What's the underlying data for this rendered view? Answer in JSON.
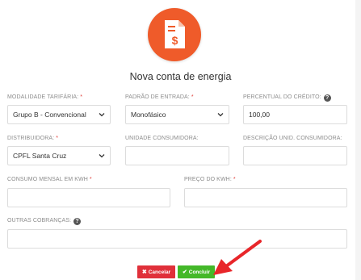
{
  "header": {
    "icon": "invoice-dollar-icon",
    "title": "Nova conta de energia"
  },
  "form": {
    "modalidade": {
      "label": "MODALIDADE TARIFÁRIA:",
      "required_mark": "*",
      "value": "Grupo B - Convencional"
    },
    "padrao": {
      "label": "PADRÃO DE ENTRADA:",
      "required_mark": "*",
      "value": "Monofásico"
    },
    "percentual": {
      "label": "PERCENTUAL DO CRÉDITO:",
      "help_icon": "question-circle-icon",
      "value": "100,00"
    },
    "distribuidora": {
      "label": "DISTRIBUIDORA:",
      "required_mark": "*",
      "value": "CPFL Santa Cruz"
    },
    "unidade": {
      "label": "UNIDADE CONSUMIDORA:",
      "value": ""
    },
    "descricao": {
      "label": "DESCRIÇÃO UNID. CONSUMIDORA:",
      "value": ""
    },
    "consumo": {
      "label": "CONSUMO MENSAL EM KWH",
      "required_mark": "*",
      "value": ""
    },
    "preco": {
      "label": "PREÇO DO KWH:",
      "required_mark": "*",
      "value": ""
    },
    "outras": {
      "label": "OUTRAS COBRANÇAS:",
      "help_icon": "question-circle-icon",
      "value": ""
    }
  },
  "footer": {
    "cancel_label": "Cancelar",
    "conclude_label": "Concluir"
  },
  "colors": {
    "accent": "#ef5b2a",
    "cancel": "#e0303a",
    "conclude": "#44b829",
    "annotation_arrow": "#e8262a"
  }
}
